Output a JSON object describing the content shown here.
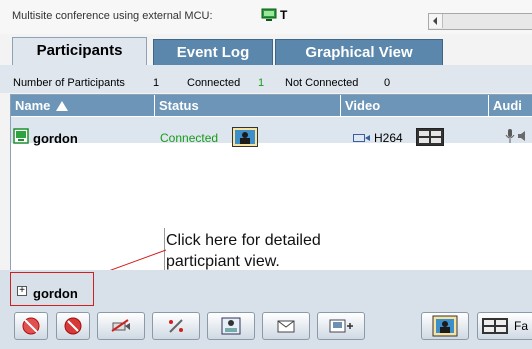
{
  "header": {
    "conference_title": "Multisite conference using external MCU:",
    "mcu_letter": "T"
  },
  "tabs": [
    {
      "label": "Participants",
      "active": true
    },
    {
      "label": "Event Log",
      "active": false
    },
    {
      "label": "Graphical View",
      "active": false
    }
  ],
  "counts": {
    "participants_label": "Number of Participants",
    "participants_value": "1",
    "connected_label": "Connected",
    "connected_value": "1",
    "not_connected_label": "Not Connected",
    "not_connected_value": "0"
  },
  "table": {
    "columns": [
      "Name",
      "Status",
      "Video",
      "Audi"
    ],
    "rows": [
      {
        "name": "gordon",
        "status": "Connected",
        "video_codec": "H264"
      }
    ]
  },
  "callout": {
    "text": "Click here for detailed particpiant view."
  },
  "detail": {
    "expand_symbol": "+",
    "name": "gordon"
  },
  "toolbar": {
    "truncated_label": "Fa"
  },
  "colors": {
    "tab_active": "#dfe6ee",
    "tab_inactive": "#5a87ab",
    "header": "#6d95b7",
    "connected": "#1a9a1a",
    "callout_border": "#d02020"
  }
}
